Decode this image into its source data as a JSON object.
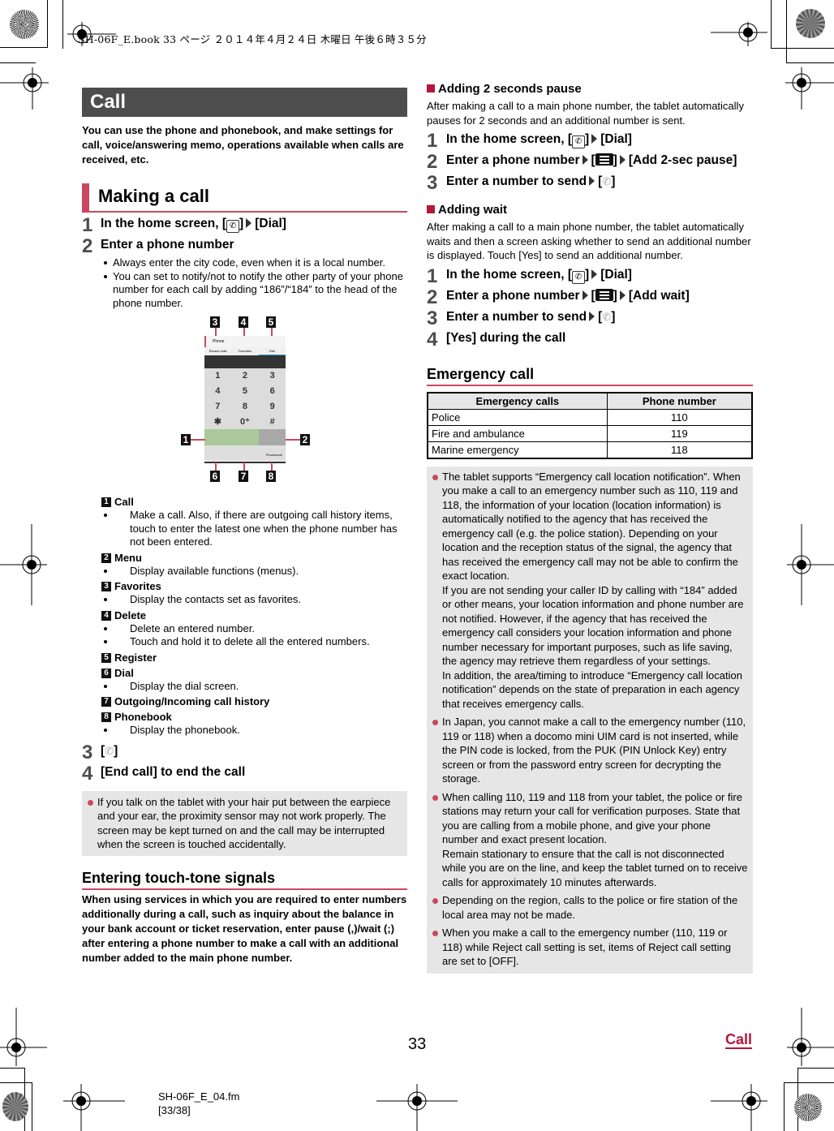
{
  "print_header": "SH-06F_E.book   33 ページ   ２０１４年４月２４日   木曜日   午後６時３５分",
  "chapter_title": "Call",
  "intro": "You can use the phone and phonebook, and make settings for call, voice/answering memo, operations available when calls are received, etc.",
  "making_call": {
    "title": "Making a call",
    "steps": [
      {
        "num": "1",
        "prefix": "In the home screen, [",
        "suffix": "]",
        "target": "[Dial]"
      },
      {
        "num": "2",
        "text": "Enter a phone number"
      },
      {
        "num": "3",
        "prefix": "[",
        "suffix": "]"
      },
      {
        "num": "4",
        "text": "[End call] to end the call"
      }
    ],
    "step2_bullets": [
      "Always enter the city code, even when it is a local number.",
      "You can set to notify/not to notify the other party of your phone number for each call by adding “186”/“184” to the head of the phone number."
    ],
    "figure": {
      "labels": [
        "1",
        "2",
        "3",
        "4",
        "5",
        "6",
        "7",
        "8"
      ],
      "screen_title": "Phone",
      "tabs": [
        "Recent calls",
        "Favorites",
        "Dial"
      ],
      "keys": [
        "1",
        "2",
        "3",
        "4",
        "5",
        "6",
        "7",
        "8",
        "9",
        "✱",
        "0⁺",
        "#"
      ],
      "nav_label": "Phonebook"
    },
    "legend": [
      {
        "num": "1",
        "title": "Call",
        "bullets": [
          "Make a call. Also, if there are outgoing call history items, touch to enter the latest one when the phone number has not been entered."
        ]
      },
      {
        "num": "2",
        "title": "Menu",
        "bullets": [
          "Display available functions (menus)."
        ]
      },
      {
        "num": "3",
        "title": "Favorites",
        "bullets": [
          "Display the contacts set as favorites."
        ]
      },
      {
        "num": "4",
        "title": "Delete",
        "bullets": [
          "Delete an entered number.",
          "Touch and hold it to delete all the entered numbers."
        ]
      },
      {
        "num": "5",
        "title": "Register",
        "bullets": []
      },
      {
        "num": "6",
        "title": "Dial",
        "bullets": [
          "Display the dial screen."
        ]
      },
      {
        "num": "7",
        "title": "Outgoing/Incoming call history",
        "bullets": []
      },
      {
        "num": "8",
        "title": "Phonebook",
        "bullets": [
          "Display the phonebook."
        ]
      }
    ],
    "note": "If you talk on the tablet with your hair put between the earpiece and your ear, the proximity sensor may not work properly. The screen may be kept turned on and the call may be interrupted when the screen is touched accidentally."
  },
  "touch_tone": {
    "title": "Entering touch-tone signals",
    "body": "When using services in which you are required to enter numbers additionally during a call, such as inquiry about the balance in your bank account or ticket reservation, enter pause (,)/wait (;) after entering a phone number to make a call with an additional number added to the main phone number."
  },
  "pause": {
    "title": "Adding 2 seconds pause",
    "body": "After making a call to a main phone number, the tablet automatically pauses for 2 seconds and an additional number is sent.",
    "step1_prefix": "In the home screen, [",
    "step1_suffix": "]",
    "step1_target": "[Dial]",
    "step2_prefix": "Enter a phone number",
    "step2_target": "[Add 2-sec pause]",
    "step3_prefix": "Enter a number to send"
  },
  "wait": {
    "title": "Adding wait",
    "body": "After making a call to a main phone number, the tablet automatically waits and then a screen asking whether to send an additional number is displayed. Touch [Yes] to send an additional number.",
    "step1_prefix": "In the home screen, [",
    "step1_suffix": "]",
    "step1_target": "[Dial]",
    "step2_prefix": "Enter a phone number",
    "step2_target": "[Add wait]",
    "step3_prefix": "Enter a number to send",
    "step4": "[Yes] during the call"
  },
  "emergency": {
    "title": "Emergency call",
    "table_headers": [
      "Emergency calls",
      "Phone number"
    ],
    "table_rows": [
      [
        "Police",
        "110"
      ],
      [
        "Fire and ambulance",
        "119"
      ],
      [
        "Marine emergency",
        "118"
      ]
    ],
    "notes": [
      "The tablet supports “Emergency call location notification”. When you make a call to an emergency number such as 110, 119 and 118, the information of your location (location information) is automatically notified to the agency that has received the emergency call (e.g. the police station). Depending on your location and the reception status of the signal, the agency that has received the emergency call may not be able to confirm the exact location.\nIf you are not sending your caller ID by calling with “184” added or other means, your location information and phone number are not notified. However, if the agency that has received the emergency call considers your location information and phone number necessary for important purposes, such as life saving, the agency may retrieve them regardless of your settings.\nIn addition, the area/timing to introduce “Emergency call location notification” depends on the state of preparation in each agency that receives emergency calls.",
      "In Japan, you cannot make a call to the emergency number (110, 119 or 118) when a docomo mini UIM card is not inserted, while the PIN code is locked, from the PUK (PIN Unlock Key) entry screen or from the password entry screen for decrypting the storage.",
      "When calling 110, 119 and 118 from your tablet, the police or fire stations may return your call for verification purposes. State that you are calling from a mobile phone, and give your phone number and exact present location.\nRemain stationary to ensure that the call is not disconnected while you are on the line, and keep the tablet turned on to receive calls for approximately 10 minutes afterwards.",
      "Depending on the region, calls to the police or fire station of the local area may not be made.",
      "When you make a call to the emergency number (110, 119 or 118) while Reject call setting is set, items of Reject call setting are set to [OFF]."
    ]
  },
  "footer": {
    "page_number": "33",
    "section_link": "Call",
    "file_name": "SH-06F_E_04.fm",
    "page_range": "[33/38]"
  },
  "colors": {
    "accent_red": "#c9485f",
    "title_red": "#b5173a",
    "chapter_bar": "#4d4d4d",
    "note_bg": "#e6e6e6"
  }
}
